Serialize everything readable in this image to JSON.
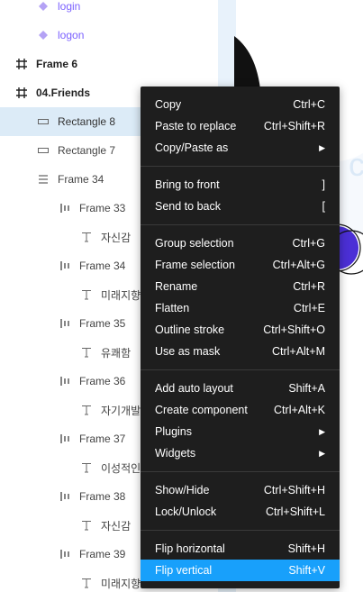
{
  "layers": [
    {
      "label": "login",
      "icon": "component-icon",
      "style": "purple",
      "indent": 40
    },
    {
      "label": "logon",
      "icon": "component-icon",
      "style": "purple",
      "indent": 40
    },
    {
      "label": "Frame 6",
      "icon": "frame-icon",
      "style": "bold",
      "indent": 16
    },
    {
      "label": "04.Friends",
      "icon": "frame-icon",
      "style": "bold",
      "indent": 16
    },
    {
      "label": "Rectangle 8",
      "icon": "rectangle-icon",
      "style": "sel",
      "indent": 40
    },
    {
      "label": "Rectangle 7",
      "icon": "rectangle-icon",
      "style": "gray",
      "indent": 40
    },
    {
      "label": "Frame 34",
      "icon": "vertical-auto-layout-icon",
      "style": "gray",
      "indent": 40
    },
    {
      "label": "Frame 33",
      "icon": "horizontal-auto-layout-icon",
      "style": "gray",
      "indent": 64
    },
    {
      "label": "자신감",
      "icon": "text-icon",
      "style": "gray",
      "indent": 88
    },
    {
      "label": "Frame 34",
      "icon": "horizontal-auto-layout-icon",
      "style": "gray",
      "indent": 64
    },
    {
      "label": "미래지향",
      "icon": "text-icon",
      "style": "gray",
      "indent": 88
    },
    {
      "label": "Frame 35",
      "icon": "horizontal-auto-layout-icon",
      "style": "gray",
      "indent": 64
    },
    {
      "label": "유쾌함",
      "icon": "text-icon",
      "style": "gray",
      "indent": 88
    },
    {
      "label": "Frame 36",
      "icon": "horizontal-auto-layout-icon",
      "style": "gray",
      "indent": 64
    },
    {
      "label": "자기개발",
      "icon": "text-icon",
      "style": "gray",
      "indent": 88
    },
    {
      "label": "Frame 37",
      "icon": "horizontal-auto-layout-icon",
      "style": "gray",
      "indent": 64
    },
    {
      "label": "이성적인",
      "icon": "text-icon",
      "style": "gray",
      "indent": 88
    },
    {
      "label": "Frame 38",
      "icon": "horizontal-auto-layout-icon",
      "style": "gray",
      "indent": 64
    },
    {
      "label": "자신감",
      "icon": "text-icon",
      "style": "gray",
      "indent": 88
    },
    {
      "label": "Frame 39",
      "icon": "horizontal-auto-layout-icon",
      "style": "gray",
      "indent": 64
    },
    {
      "label": "미래지향",
      "icon": "text-icon",
      "style": "gray",
      "indent": 88
    }
  ],
  "menu": {
    "groups": [
      [
        {
          "label": "Copy",
          "shortcut": "Ctrl+C"
        },
        {
          "label": "Paste to replace",
          "shortcut": "Ctrl+Shift+R"
        },
        {
          "label": "Copy/Paste as",
          "submenu": true
        }
      ],
      [
        {
          "label": "Bring to front",
          "shortcut": "]"
        },
        {
          "label": "Send to back",
          "shortcut": "["
        }
      ],
      [
        {
          "label": "Group selection",
          "shortcut": "Ctrl+G"
        },
        {
          "label": "Frame selection",
          "shortcut": "Ctrl+Alt+G"
        },
        {
          "label": "Rename",
          "shortcut": "Ctrl+R"
        },
        {
          "label": "Flatten",
          "shortcut": "Ctrl+E"
        },
        {
          "label": "Outline stroke",
          "shortcut": "Ctrl+Shift+O"
        },
        {
          "label": "Use as mask",
          "shortcut": "Ctrl+Alt+M"
        }
      ],
      [
        {
          "label": "Add auto layout",
          "shortcut": "Shift+A"
        },
        {
          "label": "Create component",
          "shortcut": "Ctrl+Alt+K"
        },
        {
          "label": "Plugins",
          "submenu": true
        },
        {
          "label": "Widgets",
          "submenu": true
        }
      ],
      [
        {
          "label": "Show/Hide",
          "shortcut": "Ctrl+Shift+H"
        },
        {
          "label": "Lock/Unlock",
          "shortcut": "Ctrl+Shift+L"
        }
      ],
      [
        {
          "label": "Flip horizontal",
          "shortcut": "Shift+H"
        },
        {
          "label": "Flip vertical",
          "shortcut": "Shift+V",
          "highlighted": true
        }
      ]
    ]
  },
  "colors": {
    "menu_bg": "#1e1e1e",
    "highlight": "#18a0fb",
    "selected_row": "#dcebf7",
    "component_purple": "#7b61ff"
  }
}
